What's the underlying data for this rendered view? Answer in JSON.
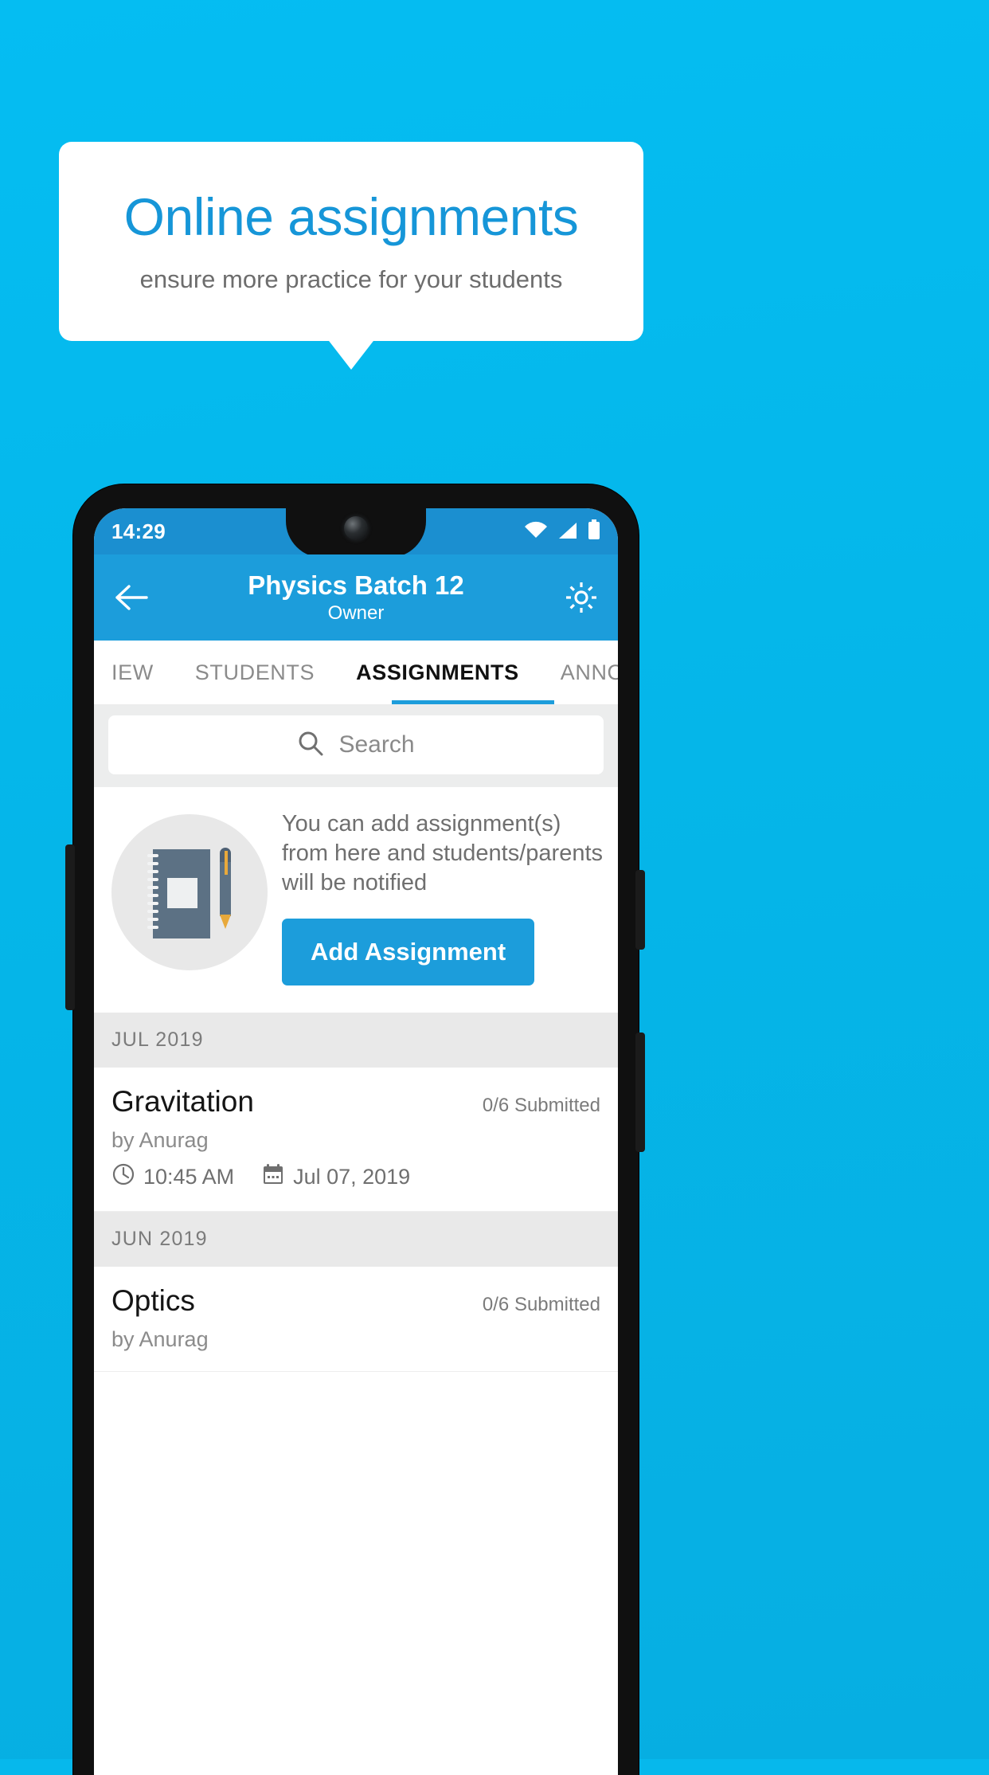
{
  "promo": {
    "headline": "Online assignments",
    "subheadline": "ensure more practice for your students",
    "headline_color": "#1696d8",
    "background_color": "#06b8ec"
  },
  "phone": {
    "status_bar": {
      "time": "14:29",
      "icons": [
        "wifi-icon",
        "signal-icon",
        "battery-icon"
      ]
    },
    "app_bar": {
      "back_icon": "back-arrow-icon",
      "title": "Physics Batch 12",
      "subtitle": "Owner",
      "settings_icon": "gear-icon",
      "color": "#1c9ddb"
    },
    "tabs": {
      "items": [
        {
          "label": "IEW",
          "active": false
        },
        {
          "label": "STUDENTS",
          "active": false
        },
        {
          "label": "ASSIGNMENTS",
          "active": true
        },
        {
          "label": "ANNOUNCEM",
          "active": false
        }
      ],
      "indicator_color": "#1c9ddb"
    },
    "search": {
      "icon": "search-icon",
      "placeholder": "Search",
      "value": ""
    },
    "empty_state": {
      "illustration": "notebook-pen-icon",
      "message": "You can add assignment(s) from here and students/parents will be notified",
      "button_label": "Add Assignment",
      "button_color": "#1c9ddb"
    },
    "assignments": [
      {
        "section": "JUL 2019",
        "items": [
          {
            "title": "Gravitation",
            "submitted": "0/6 Submitted",
            "author": "by Anurag",
            "time": "10:45 AM",
            "date": "Jul 07, 2019",
            "time_icon": "clock-icon",
            "date_icon": "calendar-icon"
          }
        ]
      },
      {
        "section": "JUN 2019",
        "items": [
          {
            "title": "Optics",
            "submitted": "0/6 Submitted",
            "author": "by Anurag",
            "time": "",
            "date": "",
            "time_icon": "clock-icon",
            "date_icon": "calendar-icon"
          }
        ]
      }
    ]
  }
}
